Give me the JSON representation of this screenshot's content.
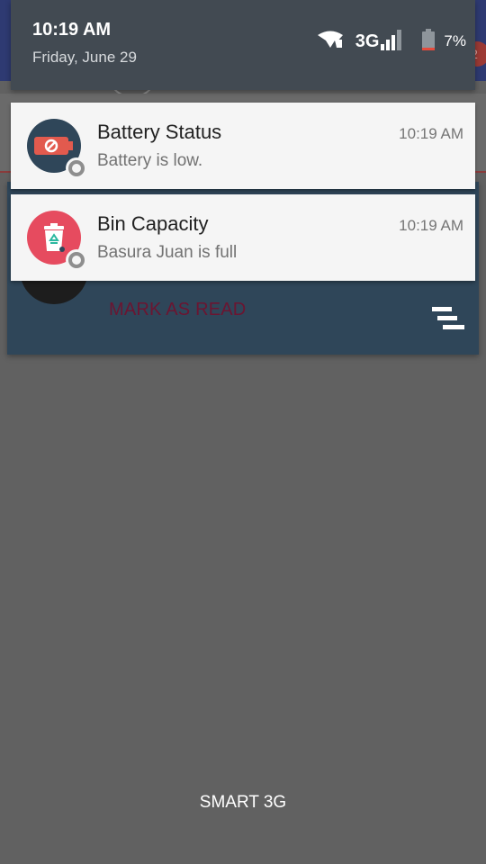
{
  "status": {
    "time": "10:19 AM",
    "date": "Friday, June 29",
    "network": "3G",
    "battery_percent": "7%",
    "icons": [
      "wifi-icon",
      "signal-icon",
      "battery-icon"
    ]
  },
  "background_app": {
    "badge_count": "2",
    "mark_as_read_label": "MARK AS READ"
  },
  "notifications": [
    {
      "title": "Battery Status",
      "text": "Battery is low.",
      "time": "10:19 AM",
      "icon": "battery-low-icon",
      "icon_color": "#2f4659"
    },
    {
      "title": "Bin Capacity",
      "text": "Basura Juan is full",
      "time": "10:19 AM",
      "icon": "recycle-bin-icon",
      "icon_color": "#e64b5f"
    }
  ],
  "carrier": "SMART 3G",
  "colors": {
    "shade_header": "#424a52",
    "notification_bg": "#f5f5f5",
    "scrim": "#616161",
    "app_card": "#2f4659",
    "app_mark_text": "#6b1531"
  }
}
